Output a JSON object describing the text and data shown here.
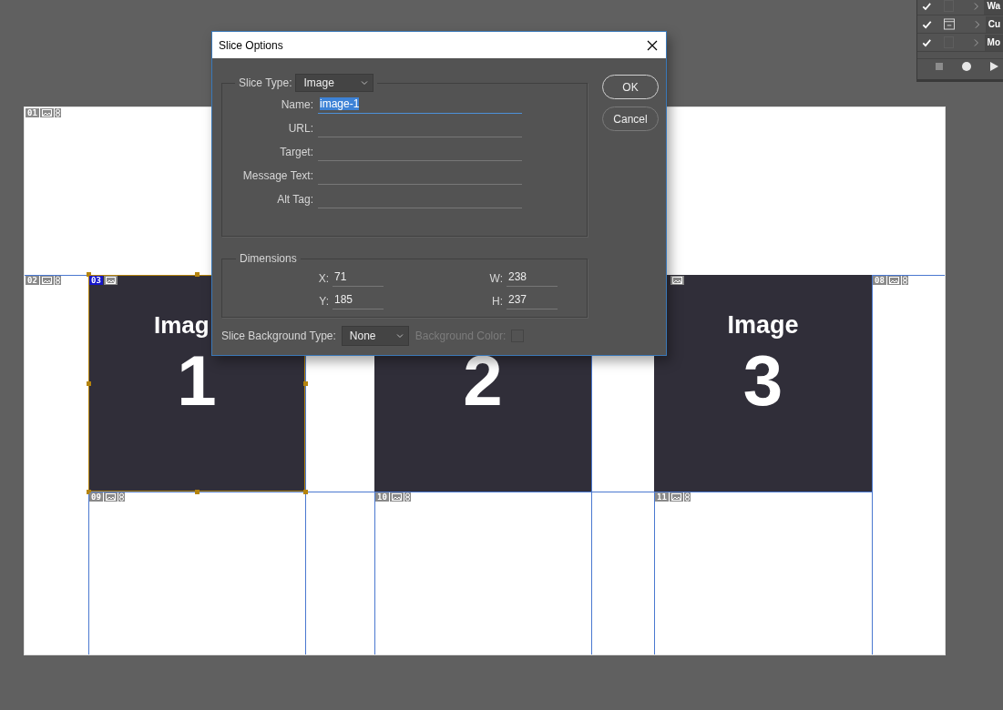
{
  "actions_panel": {
    "rows": [
      {
        "checked": true,
        "dialog": false,
        "name": "Wa"
      },
      {
        "checked": true,
        "dialog": true,
        "name": "Cu"
      },
      {
        "checked": true,
        "dialog": false,
        "name": "Mo"
      }
    ]
  },
  "document": {
    "slices": [
      {
        "number": "01",
        "kind": "auto",
        "selected": false
      },
      {
        "number": "02",
        "kind": "auto",
        "selected": false
      },
      {
        "number": "03",
        "kind": "user",
        "selected": true
      },
      {
        "kind": "user",
        "selected": false
      },
      {
        "number": "08",
        "kind": "auto",
        "selected": false
      },
      {
        "number": "09",
        "kind": "auto",
        "selected": false
      },
      {
        "number": "10",
        "kind": "auto",
        "selected": false
      },
      {
        "number": "11",
        "kind": "auto",
        "selected": false
      }
    ],
    "images": [
      {
        "title": "Imag",
        "number": "1"
      },
      {
        "number": "2"
      },
      {
        "title": "Image",
        "number": "3"
      }
    ]
  },
  "dialog": {
    "title": "Slice Options",
    "slice_type": {
      "label": "Slice Type:",
      "value": "Image"
    },
    "fields": [
      {
        "label": "Name:",
        "value": "image-1",
        "selected": true
      },
      {
        "label": "URL:",
        "selected": false
      },
      {
        "label": "Target:",
        "selected": false
      },
      {
        "label": "Message Text:",
        "selected": false
      },
      {
        "label": "Alt Tag:",
        "selected": false
      }
    ],
    "dimensions": {
      "title": "Dimensions",
      "fields": [
        {
          "label": "X:",
          "value": "71"
        },
        {
          "label": "W:",
          "value": "238"
        },
        {
          "label": "Y:",
          "value": "185"
        },
        {
          "label": "H:",
          "value": "237"
        }
      ]
    },
    "background_type": {
      "label": "Slice Background Type:",
      "value": "None"
    },
    "background_color": {
      "label": "Background Color:",
      "disabled": true
    },
    "buttons": [
      {
        "label": "OK",
        "default": true
      },
      {
        "label": "Cancel",
        "default": false
      }
    ]
  }
}
